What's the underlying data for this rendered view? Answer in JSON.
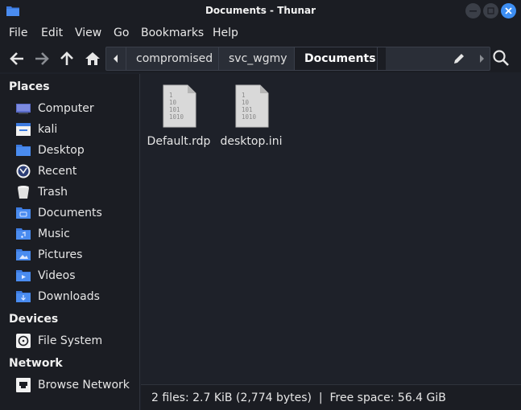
{
  "window": {
    "title": "Documents - Thunar"
  },
  "menubar": {
    "items": [
      "File",
      "Edit",
      "View",
      "Go",
      "Bookmarks",
      "Help"
    ]
  },
  "pathbar": {
    "crumbs": [
      "compromised",
      "svc_wgmy",
      "Documents"
    ],
    "active_index": 2
  },
  "sidebar": {
    "places_label": "Places",
    "places": [
      {
        "label": "Computer",
        "icon": "computer-icon"
      },
      {
        "label": "kali",
        "icon": "home-folder-icon"
      },
      {
        "label": "Desktop",
        "icon": "desktop-icon"
      },
      {
        "label": "Recent",
        "icon": "recent-icon"
      },
      {
        "label": "Trash",
        "icon": "trash-icon"
      },
      {
        "label": "Documents",
        "icon": "documents-folder-icon"
      },
      {
        "label": "Music",
        "icon": "music-folder-icon"
      },
      {
        "label": "Pictures",
        "icon": "pictures-folder-icon"
      },
      {
        "label": "Videos",
        "icon": "videos-folder-icon"
      },
      {
        "label": "Downloads",
        "icon": "downloads-folder-icon"
      }
    ],
    "devices_label": "Devices",
    "devices": [
      {
        "label": "File System",
        "icon": "drive-icon"
      }
    ],
    "network_label": "Network",
    "network": [
      {
        "label": "Browse Network",
        "icon": "network-icon"
      }
    ]
  },
  "files": [
    {
      "name": "Default.rdp",
      "icon": "binary-file-icon"
    },
    {
      "name": "desktop.ini",
      "icon": "binary-file-icon"
    }
  ],
  "binary_glyph": [
    "1",
    "10",
    "101",
    "1010"
  ],
  "status": {
    "text": "2 files: 2.7 KiB (2,774 bytes)  |  Free space: 56.4 GiB"
  },
  "colors": {
    "accent": "#3d8ef2",
    "folder": "#3d7be0",
    "window_bg": "#1e2129",
    "panel_bg": "#1b1d23"
  }
}
